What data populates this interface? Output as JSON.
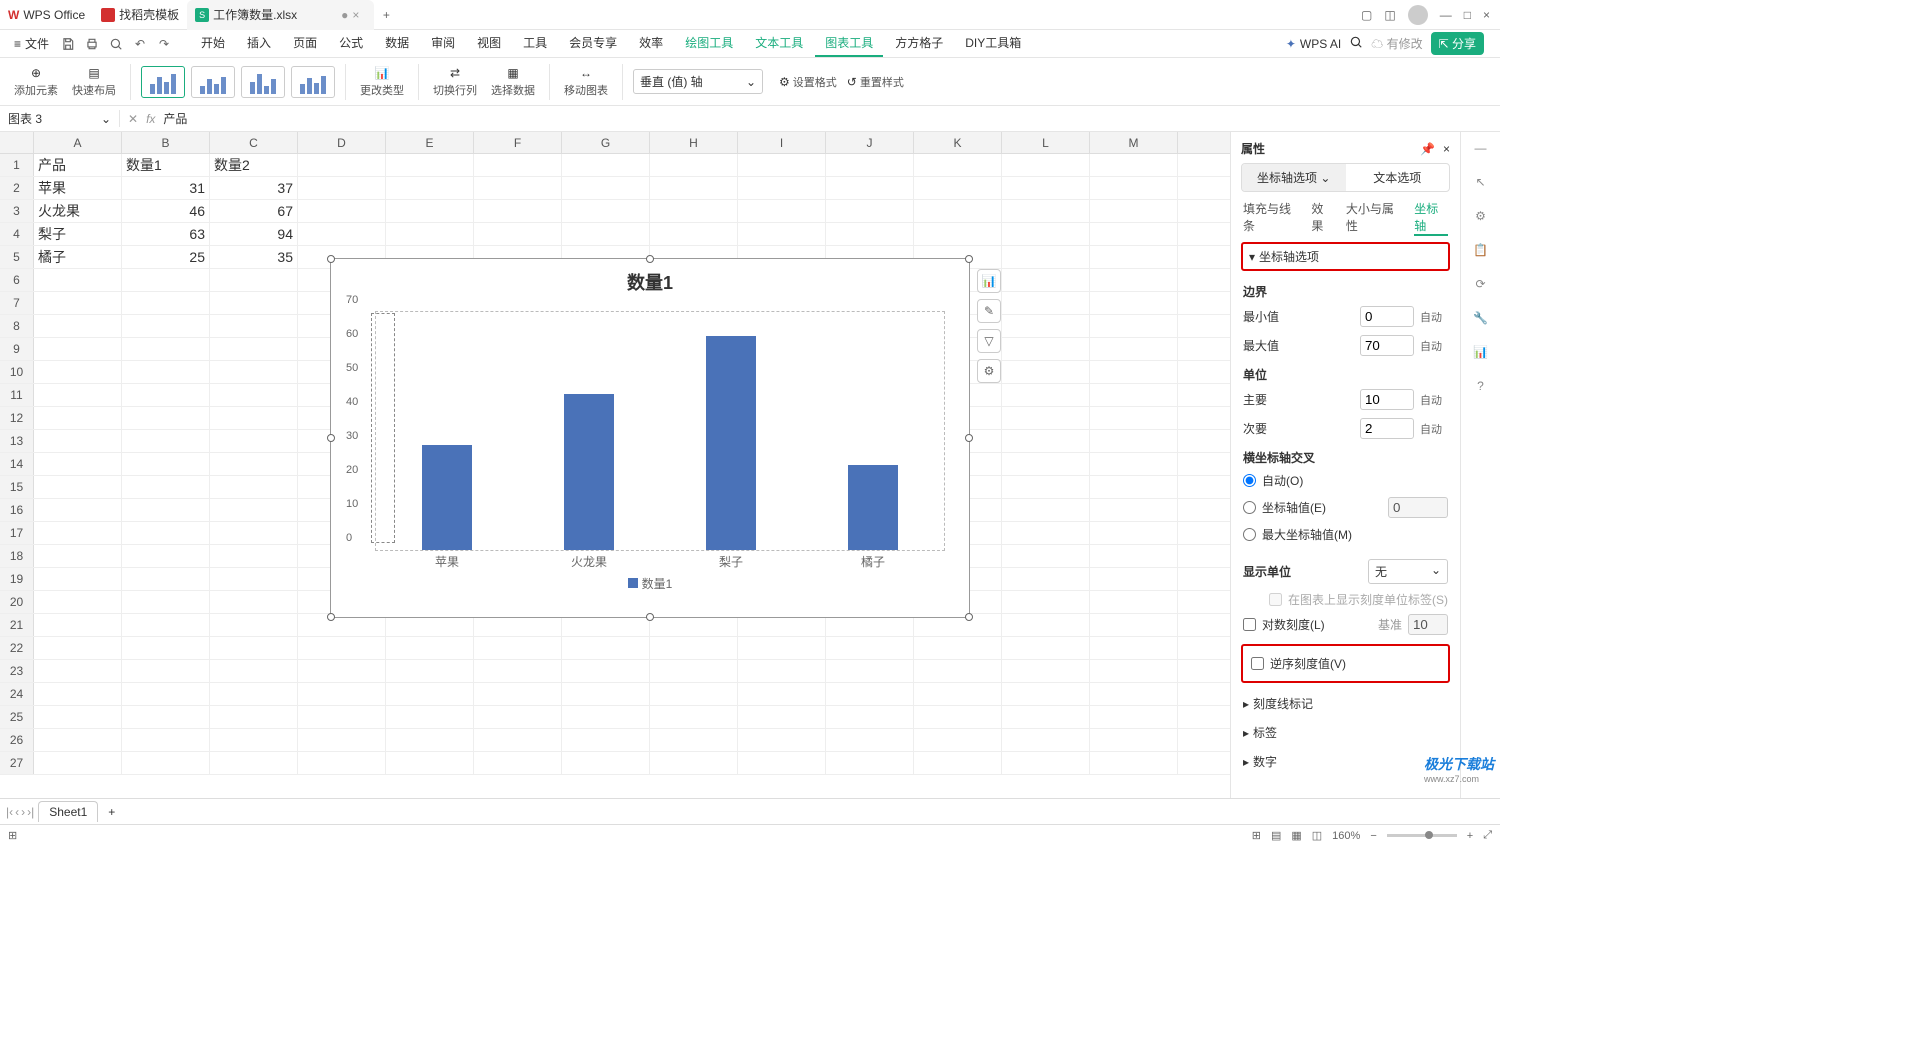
{
  "titlebar": {
    "tabs": [
      {
        "label": "WPS Office",
        "icon_color": "#d32f2f"
      },
      {
        "label": "找稻壳模板",
        "icon_color": "#d32f2f"
      },
      {
        "label": "工作簿数量.xlsx",
        "icon_color": "#1aad7e",
        "dirty": "●"
      }
    ]
  },
  "menubar": {
    "file_label": "文件",
    "items": [
      "开始",
      "插入",
      "页面",
      "公式",
      "数据",
      "审阅",
      "视图",
      "工具",
      "会员专享",
      "效率"
    ],
    "green_items": [
      "绘图工具",
      "文本工具",
      "图表工具",
      "方方格子",
      "DIY工具箱"
    ],
    "active_green": "图表工具",
    "wps_ai": "WPS AI",
    "modify": "有修改",
    "share": "分享"
  },
  "ribbon": {
    "g1": "添加元素",
    "g2": "快速布局",
    "g3": "更改类型",
    "g4": "切换行列",
    "g5": "选择数据",
    "g6": "移动图表",
    "g7": "设置格式",
    "g8": "重置样式",
    "axis_select": "垂直 (值) 轴"
  },
  "name_box": "图表 3",
  "formula_text": "产品",
  "columns": [
    "A",
    "B",
    "C",
    "D",
    "E",
    "F",
    "G",
    "H",
    "I",
    "J",
    "K",
    "L",
    "M"
  ],
  "row_headers": [
    1,
    2,
    3,
    4,
    5,
    6,
    7,
    8,
    9,
    10,
    11,
    12,
    13,
    14,
    15,
    16,
    17,
    18,
    19,
    20,
    21,
    22,
    23,
    24,
    25,
    26,
    27
  ],
  "cells": {
    "A1": "产品",
    "B1": "数量1",
    "C1": "数量2",
    "A2": "苹果",
    "B2": "31",
    "C2": "37",
    "A3": "火龙果",
    "B3": "46",
    "C3": "67",
    "A4": "梨子",
    "B4": "63",
    "C4": "94",
    "A5": "橘子",
    "B5": "25",
    "C5": "35"
  },
  "chart_data": {
    "type": "bar",
    "title": "数量1",
    "categories": [
      "苹果",
      "火龙果",
      "梨子",
      "橘子"
    ],
    "values": [
      31,
      46,
      63,
      25
    ],
    "y_ticks": [
      0,
      10,
      20,
      30,
      40,
      50,
      60,
      70
    ],
    "ylim": [
      0,
      70
    ],
    "legend": "数量1",
    "xlabel": "",
    "ylabel": ""
  },
  "side": {
    "title": "属性",
    "tab_axis": "坐标轴选项",
    "tab_text": "文本选项",
    "sub1": "填充与线条",
    "sub2": "效果",
    "sub3": "大小与属性",
    "sub4": "坐标轴",
    "sec_axis_options": "坐标轴选项",
    "bounds": "边界",
    "min": "最小值",
    "min_v": "0",
    "min_auto": "自动",
    "max": "最大值",
    "max_v": "70",
    "max_auto": "自动",
    "unit": "单位",
    "major": "主要",
    "major_v": "10",
    "major_auto": "自动",
    "minor": "次要",
    "minor_v": "2",
    "minor_auto": "自动",
    "cross": "横坐标轴交叉",
    "cross_auto": "自动(O)",
    "cross_val": "坐标轴值(E)",
    "cross_val_v": "0",
    "cross_max": "最大坐标轴值(M)",
    "disp_unit": "显示单位",
    "disp_unit_v": "无",
    "disp_label": "在图表上显示刻度单位标签(S)",
    "log": "对数刻度(L)",
    "log_base_l": "基准",
    "log_base_v": "10",
    "reverse": "逆序刻度值(V)",
    "tick_marks": "刻度线标记",
    "labels": "标签",
    "number": "数字"
  },
  "sheet_tab": "Sheet1",
  "status": {
    "zoom": "160%"
  },
  "watermark": {
    "line1": "极光下载站",
    "line2": "www.xz7.com"
  }
}
